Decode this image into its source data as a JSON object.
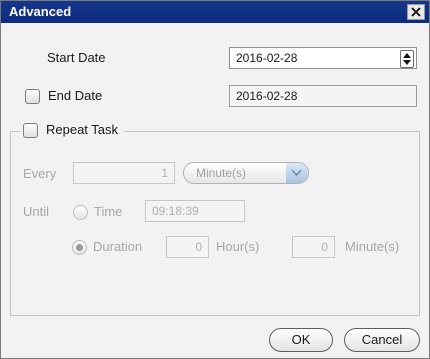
{
  "window": {
    "title": "Advanced",
    "close_icon": "close-x-icon"
  },
  "start_date": {
    "label": "Start Date",
    "value": "2016-02-28",
    "spinner_icon": "up-down-spinner-icon"
  },
  "end_date": {
    "label": "End Date",
    "checked": false,
    "value": "2016-02-28"
  },
  "repeat": {
    "label": "Repeat Task",
    "checked": false,
    "every_label": "Every",
    "every_value": "1",
    "unit_selected": "Minute(s)",
    "until_label": "Until",
    "time_option_label": "Time",
    "time_selected": false,
    "time_value": "09:18:39",
    "duration_option_label": "Duration",
    "duration_selected": true,
    "duration_hours": "0",
    "hours_unit_label": "Hour(s)",
    "duration_minutes": "0",
    "minutes_unit_label": "Minute(s)"
  },
  "buttons": {
    "ok": "OK",
    "cancel": "Cancel"
  },
  "colors": {
    "titlebar": "#0b2c82",
    "dialog_bg": "#f2f2f2",
    "disabled_text": "#a7a7a7"
  }
}
